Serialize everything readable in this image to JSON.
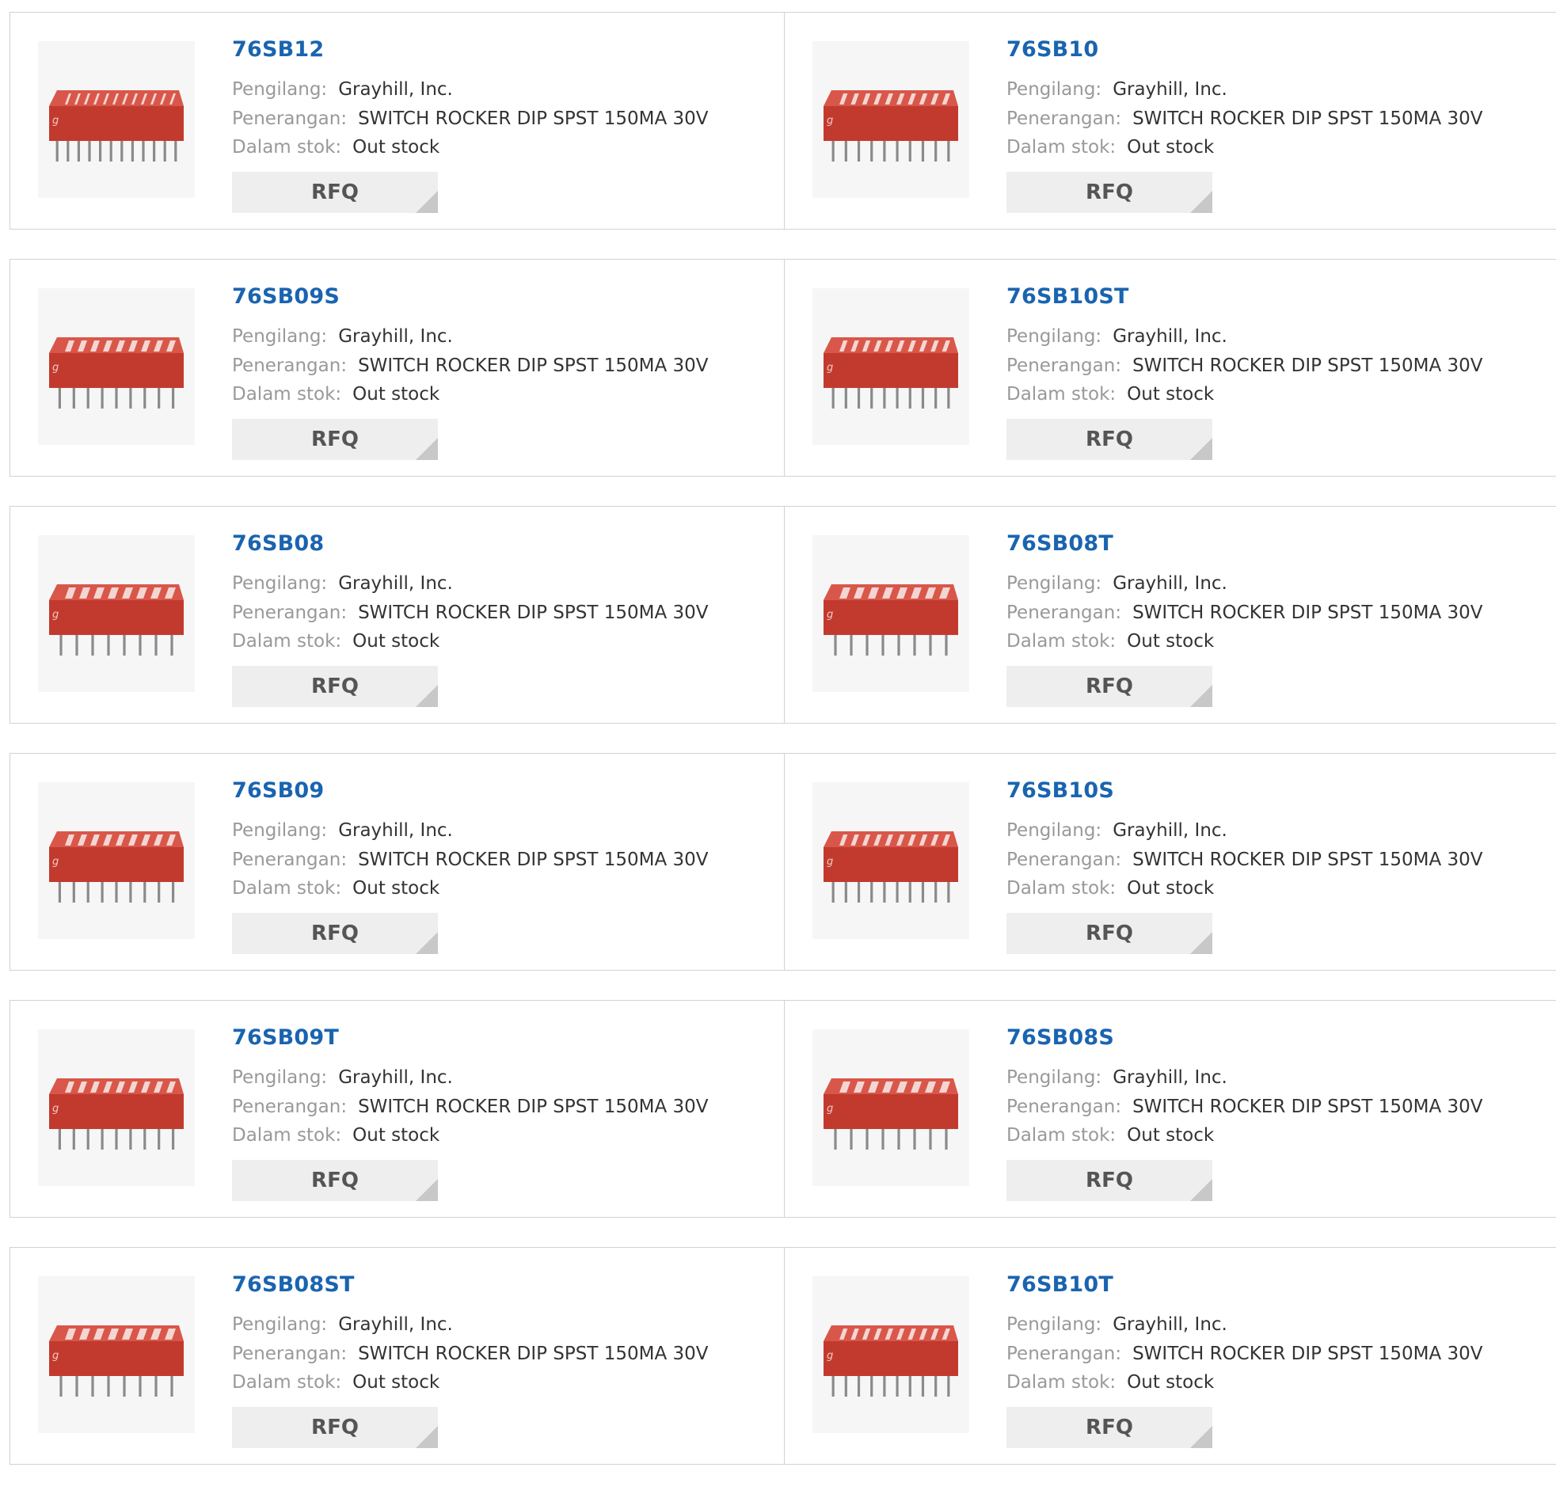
{
  "labels": {
    "manufacturer": "Pengilang:",
    "description": "Penerangan:",
    "stock": "Dalam stok:",
    "rfq": "RFQ"
  },
  "products": [
    {
      "part": "76SB12",
      "manufacturer": "Grayhill, Inc.",
      "description": "SWITCH ROCKER DIP SPST 150MA 30V",
      "stock": "Out stock",
      "switches": 12
    },
    {
      "part": "76SB10",
      "manufacturer": "Grayhill, Inc.",
      "description": "SWITCH ROCKER DIP SPST 150MA 30V",
      "stock": "Out stock",
      "switches": 10
    },
    {
      "part": "76SB09S",
      "manufacturer": "Grayhill, Inc.",
      "description": "SWITCH ROCKER DIP SPST 150MA 30V",
      "stock": "Out stock",
      "switches": 9
    },
    {
      "part": "76SB10ST",
      "manufacturer": "Grayhill, Inc.",
      "description": "SWITCH ROCKER DIP SPST 150MA 30V",
      "stock": "Out stock",
      "switches": 10
    },
    {
      "part": "76SB08",
      "manufacturer": "Grayhill, Inc.",
      "description": "SWITCH ROCKER DIP SPST 150MA 30V",
      "stock": "Out stock",
      "switches": 8
    },
    {
      "part": "76SB08T",
      "manufacturer": "Grayhill, Inc.",
      "description": "SWITCH ROCKER DIP SPST 150MA 30V",
      "stock": "Out stock",
      "switches": 8
    },
    {
      "part": "76SB09",
      "manufacturer": "Grayhill, Inc.",
      "description": "SWITCH ROCKER DIP SPST 150MA 30V",
      "stock": "Out stock",
      "switches": 9
    },
    {
      "part": "76SB10S",
      "manufacturer": "Grayhill, Inc.",
      "description": "SWITCH ROCKER DIP SPST 150MA 30V",
      "stock": "Out stock",
      "switches": 10
    },
    {
      "part": "76SB09T",
      "manufacturer": "Grayhill, Inc.",
      "description": "SWITCH ROCKER DIP SPST 150MA 30V",
      "stock": "Out stock",
      "switches": 9
    },
    {
      "part": "76SB08S",
      "manufacturer": "Grayhill, Inc.",
      "description": "SWITCH ROCKER DIP SPST 150MA 30V",
      "stock": "Out stock",
      "switches": 8
    },
    {
      "part": "76SB08ST",
      "manufacturer": "Grayhill, Inc.",
      "description": "SWITCH ROCKER DIP SPST 150MA 30V",
      "stock": "Out stock",
      "switches": 8
    },
    {
      "part": "76SB10T",
      "manufacturer": "Grayhill, Inc.",
      "description": "SWITCH ROCKER DIP SPST 150MA 30V",
      "stock": "Out stock",
      "switches": 10
    }
  ],
  "colors": {
    "part_link": "#1a64b0",
    "switch_body": "#c23a2e",
    "switch_top": "#d9574a",
    "rocker": "#f3d6d2"
  },
  "icons": {
    "product_image": "dip-switch-icon",
    "rfq_corner": "triangle-corner-icon"
  }
}
